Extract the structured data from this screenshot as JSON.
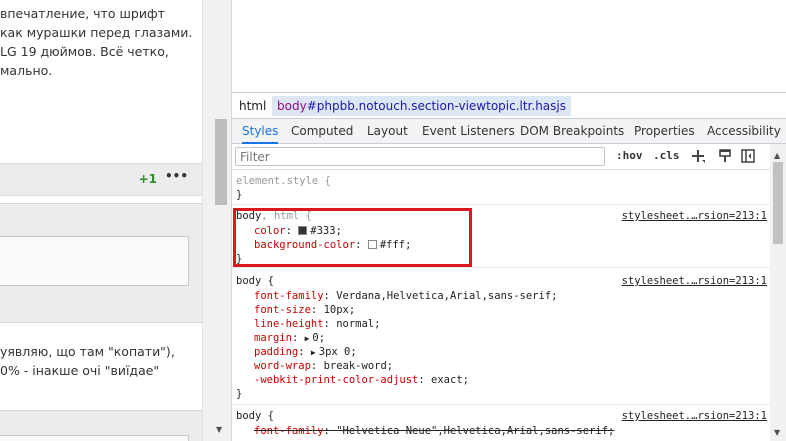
{
  "page": {
    "post1_lines": [
      "впечатление, что шрифт",
      "как мурашки перед глазами.",
      "LG 19 дюймов. Всё четко,",
      "мально."
    ],
    "votes": "+1",
    "menu": "•••",
    "post2_lines": [
      "уявляю, що там \"копати\"),",
      "0% - інакше очі \"виїдае\""
    ]
  },
  "devtools": {
    "breadcrumbs": {
      "html": "html",
      "body_tag": "body",
      "body_rest": "#phpbb.notouch.section-viewtopic.ltr.hasjs"
    },
    "tabs": [
      "Styles",
      "Computed",
      "Layout",
      "Event Listeners",
      "DOM Breakpoints",
      "Properties",
      "Accessibility"
    ],
    "active_tab": "Styles",
    "filter_placeholder": "Filter",
    "hov": ":hov",
    "cls": ".cls",
    "rules": {
      "element_style": {
        "selector": "element.style {",
        "close": "}"
      },
      "r1": {
        "selector_main": "body",
        "selector_rest": ", html {",
        "source": "stylesheet.…rsion=213:1",
        "props": [
          {
            "name": "color",
            "value": "#333",
            "swatch": "#333333"
          },
          {
            "name": "background-color",
            "value": "#fff",
            "swatch": "#ffffff"
          }
        ],
        "close": "}"
      },
      "r2": {
        "selector": "body {",
        "source": "stylesheet.…rsion=213:1",
        "props": [
          {
            "name": "font-family",
            "value": "Verdana,Helvetica,Arial,sans-serif"
          },
          {
            "name": "font-size",
            "value": "10px"
          },
          {
            "name": "line-height",
            "value": "normal"
          },
          {
            "name": "margin",
            "value": "0"
          },
          {
            "name": "padding",
            "value": "3px 0"
          },
          {
            "name": "word-wrap",
            "value": "break-word"
          },
          {
            "name": "-webkit-print-color-adjust",
            "value": "exact"
          }
        ],
        "close": "}"
      },
      "r3": {
        "selector": "body {",
        "source": "stylesheet.…rsion=213:1",
        "props": [
          {
            "name": "font-family",
            "value": "\"Helvetica Neue\",Helvetica,Arial,sans-serif"
          }
        ]
      }
    }
  },
  "colors": {
    "accent": "#1a73e8",
    "highlight_box": "#d61a1f",
    "property_name": "#c80000",
    "votes_green": "#2e8b2e"
  }
}
